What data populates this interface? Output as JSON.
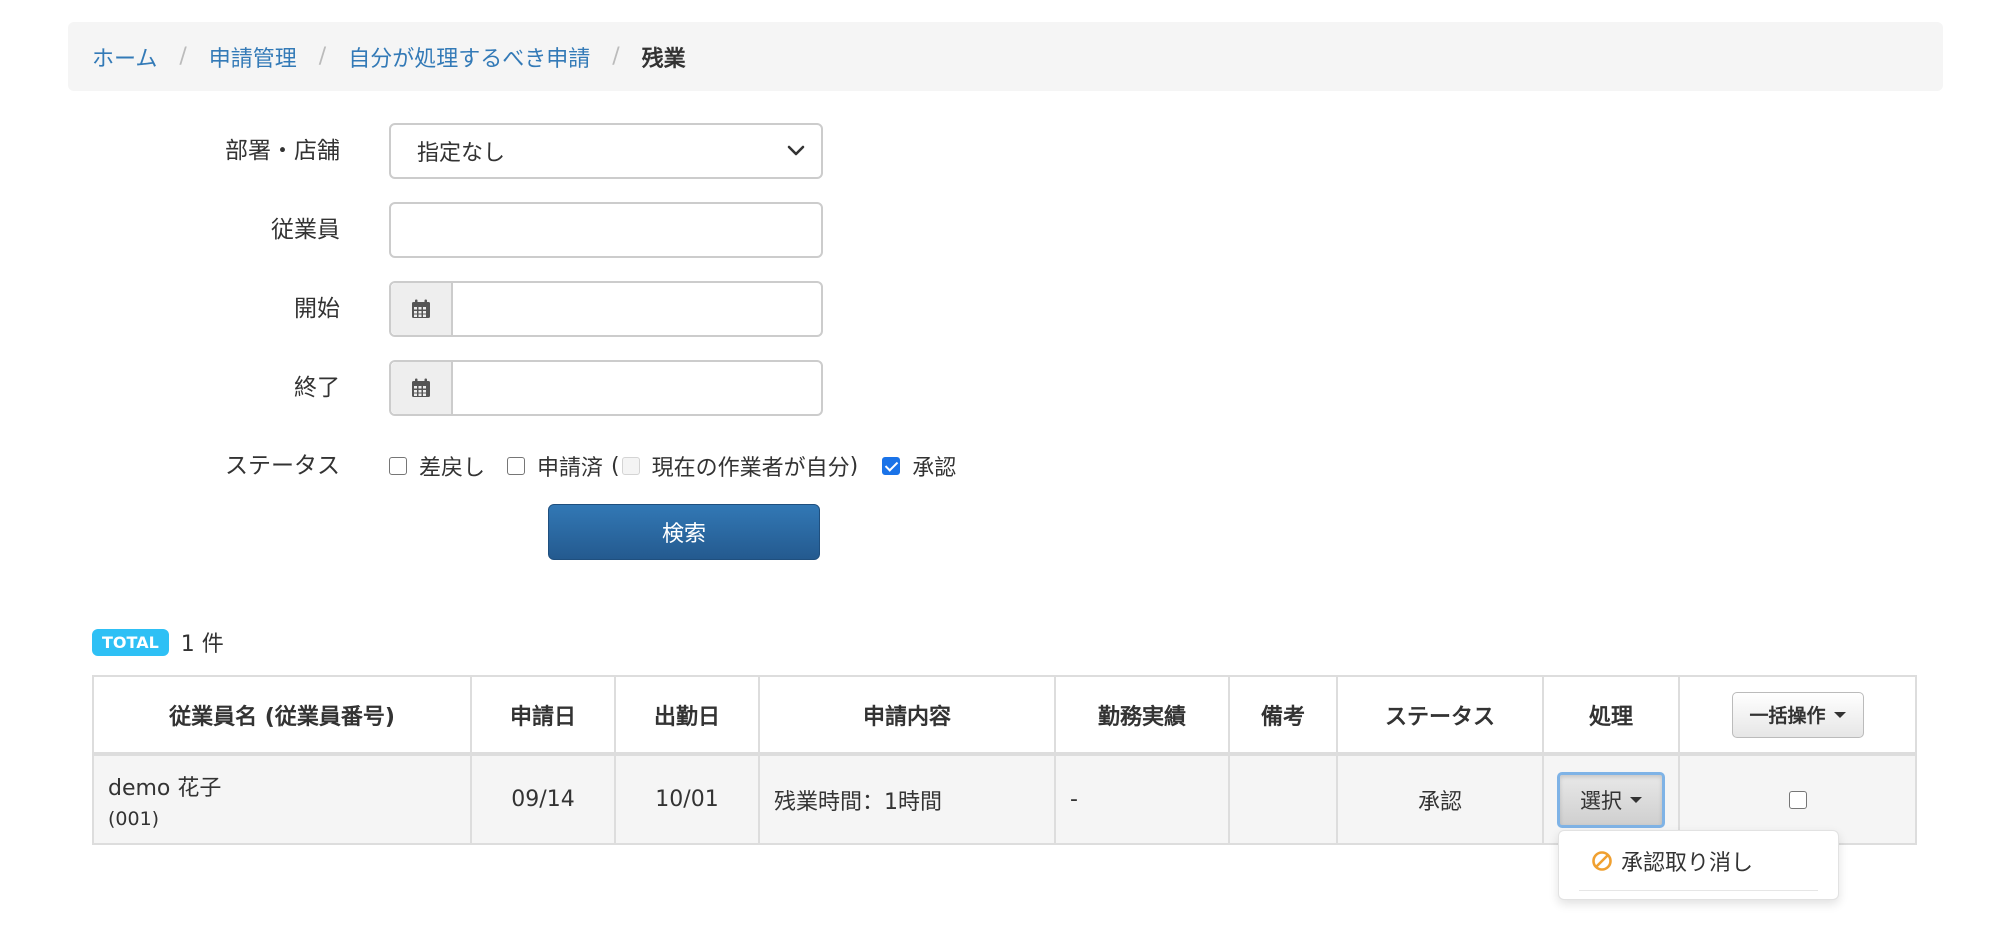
{
  "breadcrumb": {
    "items": [
      "ホーム",
      "申請管理",
      "自分が処理するべき申請"
    ],
    "separator": "/",
    "current": "残業"
  },
  "form": {
    "department_label": "部署・店舗",
    "department_value": "指定なし",
    "employee_label": "従業員",
    "employee_value": "",
    "start_label": "開始",
    "start_value": "",
    "end_label": "終了",
    "end_value": "",
    "status_label": "ステータス",
    "status_options": [
      {
        "label": "差戻し",
        "checked": false
      },
      {
        "label": "申請済",
        "checked": false
      },
      {
        "label": "現在の作業者が自分",
        "checked": false,
        "disabled": true
      },
      {
        "label": "承認",
        "checked": true
      }
    ],
    "paren_open": "(",
    "paren_close": ")",
    "search_button": "検索"
  },
  "total": {
    "badge": "TOTAL",
    "count_text": "1 件"
  },
  "table": {
    "headers": [
      "従業員名 (従業員番号)",
      "申請日",
      "出勤日",
      "申請内容",
      "勤務実績",
      "備考",
      "ステータス",
      "処理"
    ],
    "bulk_button": "一括操作",
    "rows": [
      {
        "name": "demo 花子",
        "code": "(001)",
        "apply_date": "09/14",
        "work_date": "10/01",
        "content": "残業時間：1時間",
        "result": "-",
        "note": "",
        "status": "承認",
        "action_button": "選択"
      }
    ]
  },
  "dropdown": {
    "items": [
      "承認取り消し"
    ]
  },
  "colors": {
    "link": "#337ab7",
    "primary_button": "#2a6aa3",
    "total_badge": "#2ec0f5",
    "ban_icon": "#f0a030"
  }
}
